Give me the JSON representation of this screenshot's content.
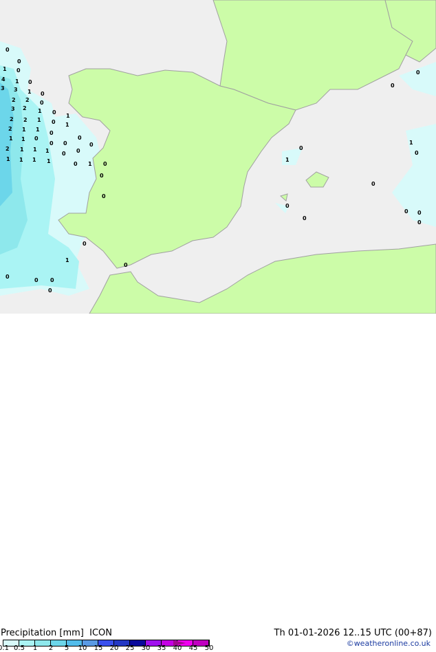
{
  "map": {
    "sea_color": "#efefef",
    "land_color": "#ccfca8",
    "border_color": "#a0a0a0",
    "precip_labels": [
      "0",
      "0",
      "1",
      "0",
      "4",
      "1",
      "0",
      "3",
      "3",
      "1",
      "0",
      "2",
      "2",
      "0",
      "3",
      "2",
      "1",
      "0",
      "2",
      "2",
      "1",
      "0",
      "1",
      "2",
      "1",
      "1",
      "0",
      "1",
      "1",
      "1",
      "0",
      "0",
      "2",
      "1",
      "1",
      "1",
      "0",
      "0",
      "1",
      "1",
      "1",
      "1",
      "0",
      "0",
      "0",
      "0",
      "1",
      "0",
      "0",
      "1",
      "1",
      "0",
      "0",
      "0",
      "0",
      "0",
      "0",
      "0",
      "0",
      "0",
      "0",
      "1",
      "0",
      "0",
      "0",
      "0",
      "0",
      "0",
      "0"
    ]
  },
  "legend": {
    "title": "Precipitation [mm]",
    "model": "ICON",
    "ticks": [
      "0.1",
      "0.5",
      "1",
      "2",
      "5",
      "10",
      "15",
      "20",
      "25",
      "30",
      "35",
      "40",
      "45",
      "50"
    ],
    "colors": [
      "#d8fafa",
      "#aaf4f4",
      "#8ee8ec",
      "#6cd6ea",
      "#52bceb",
      "#5a9ae4",
      "#3a50ee",
      "#2438c4",
      "#0a0a9c",
      "#a010ee",
      "#c400e4",
      "#f000f0",
      "#c000c0"
    ],
    "arrow_color": "#a0088c"
  },
  "header": {
    "datetime": "Th 01-01-2026 12..15 UTC (00+87)",
    "credit": "©weatheronline.co.uk"
  }
}
